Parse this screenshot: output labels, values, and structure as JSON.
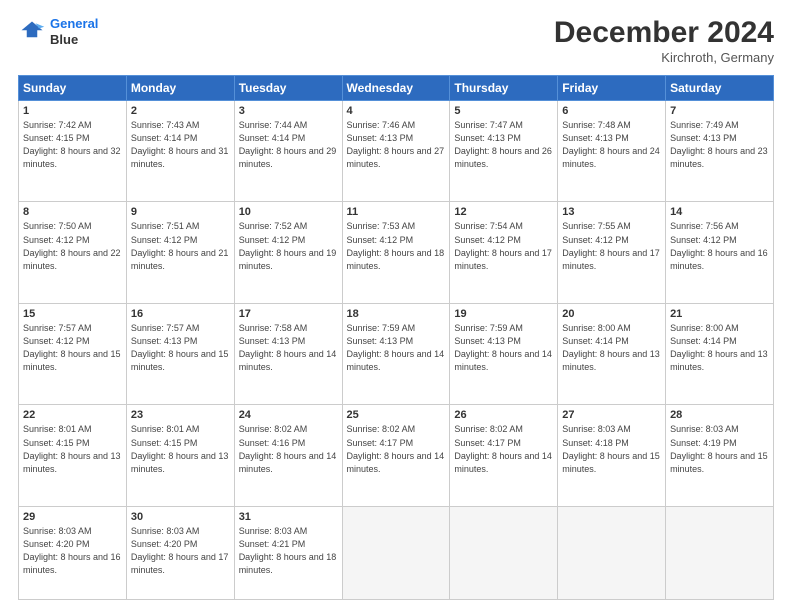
{
  "header": {
    "logo_line1": "General",
    "logo_line2": "Blue",
    "month": "December 2024",
    "location": "Kirchroth, Germany"
  },
  "weekdays": [
    "Sunday",
    "Monday",
    "Tuesday",
    "Wednesday",
    "Thursday",
    "Friday",
    "Saturday"
  ],
  "weeks": [
    [
      {
        "day": "1",
        "sunrise": "7:42 AM",
        "sunset": "4:15 PM",
        "daylight": "8 hours and 32 minutes."
      },
      {
        "day": "2",
        "sunrise": "7:43 AM",
        "sunset": "4:14 PM",
        "daylight": "8 hours and 31 minutes."
      },
      {
        "day": "3",
        "sunrise": "7:44 AM",
        "sunset": "4:14 PM",
        "daylight": "8 hours and 29 minutes."
      },
      {
        "day": "4",
        "sunrise": "7:46 AM",
        "sunset": "4:13 PM",
        "daylight": "8 hours and 27 minutes."
      },
      {
        "day": "5",
        "sunrise": "7:47 AM",
        "sunset": "4:13 PM",
        "daylight": "8 hours and 26 minutes."
      },
      {
        "day": "6",
        "sunrise": "7:48 AM",
        "sunset": "4:13 PM",
        "daylight": "8 hours and 24 minutes."
      },
      {
        "day": "7",
        "sunrise": "7:49 AM",
        "sunset": "4:13 PM",
        "daylight": "8 hours and 23 minutes."
      }
    ],
    [
      {
        "day": "8",
        "sunrise": "7:50 AM",
        "sunset": "4:12 PM",
        "daylight": "8 hours and 22 minutes."
      },
      {
        "day": "9",
        "sunrise": "7:51 AM",
        "sunset": "4:12 PM",
        "daylight": "8 hours and 21 minutes."
      },
      {
        "day": "10",
        "sunrise": "7:52 AM",
        "sunset": "4:12 PM",
        "daylight": "8 hours and 19 minutes."
      },
      {
        "day": "11",
        "sunrise": "7:53 AM",
        "sunset": "4:12 PM",
        "daylight": "8 hours and 18 minutes."
      },
      {
        "day": "12",
        "sunrise": "7:54 AM",
        "sunset": "4:12 PM",
        "daylight": "8 hours and 17 minutes."
      },
      {
        "day": "13",
        "sunrise": "7:55 AM",
        "sunset": "4:12 PM",
        "daylight": "8 hours and 17 minutes."
      },
      {
        "day": "14",
        "sunrise": "7:56 AM",
        "sunset": "4:12 PM",
        "daylight": "8 hours and 16 minutes."
      }
    ],
    [
      {
        "day": "15",
        "sunrise": "7:57 AM",
        "sunset": "4:12 PM",
        "daylight": "8 hours and 15 minutes."
      },
      {
        "day": "16",
        "sunrise": "7:57 AM",
        "sunset": "4:13 PM",
        "daylight": "8 hours and 15 minutes."
      },
      {
        "day": "17",
        "sunrise": "7:58 AM",
        "sunset": "4:13 PM",
        "daylight": "8 hours and 14 minutes."
      },
      {
        "day": "18",
        "sunrise": "7:59 AM",
        "sunset": "4:13 PM",
        "daylight": "8 hours and 14 minutes."
      },
      {
        "day": "19",
        "sunrise": "7:59 AM",
        "sunset": "4:13 PM",
        "daylight": "8 hours and 14 minutes."
      },
      {
        "day": "20",
        "sunrise": "8:00 AM",
        "sunset": "4:14 PM",
        "daylight": "8 hours and 13 minutes."
      },
      {
        "day": "21",
        "sunrise": "8:00 AM",
        "sunset": "4:14 PM",
        "daylight": "8 hours and 13 minutes."
      }
    ],
    [
      {
        "day": "22",
        "sunrise": "8:01 AM",
        "sunset": "4:15 PM",
        "daylight": "8 hours and 13 minutes."
      },
      {
        "day": "23",
        "sunrise": "8:01 AM",
        "sunset": "4:15 PM",
        "daylight": "8 hours and 13 minutes."
      },
      {
        "day": "24",
        "sunrise": "8:02 AM",
        "sunset": "4:16 PM",
        "daylight": "8 hours and 14 minutes."
      },
      {
        "day": "25",
        "sunrise": "8:02 AM",
        "sunset": "4:17 PM",
        "daylight": "8 hours and 14 minutes."
      },
      {
        "day": "26",
        "sunrise": "8:02 AM",
        "sunset": "4:17 PM",
        "daylight": "8 hours and 14 minutes."
      },
      {
        "day": "27",
        "sunrise": "8:03 AM",
        "sunset": "4:18 PM",
        "daylight": "8 hours and 15 minutes."
      },
      {
        "day": "28",
        "sunrise": "8:03 AM",
        "sunset": "4:19 PM",
        "daylight": "8 hours and 15 minutes."
      }
    ],
    [
      {
        "day": "29",
        "sunrise": "8:03 AM",
        "sunset": "4:20 PM",
        "daylight": "8 hours and 16 minutes."
      },
      {
        "day": "30",
        "sunrise": "8:03 AM",
        "sunset": "4:20 PM",
        "daylight": "8 hours and 17 minutes."
      },
      {
        "day": "31",
        "sunrise": "8:03 AM",
        "sunset": "4:21 PM",
        "daylight": "8 hours and 18 minutes."
      },
      null,
      null,
      null,
      null
    ]
  ]
}
